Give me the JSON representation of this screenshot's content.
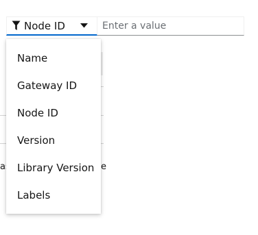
{
  "filter": {
    "selected_label": "Node ID",
    "filter_icon": "filter-icon",
    "caret_icon": "caret-down-icon"
  },
  "search": {
    "placeholder": "Enter a value",
    "value": ""
  },
  "menu": {
    "items": [
      {
        "label": "Name"
      },
      {
        "label": "Gateway ID"
      },
      {
        "label": "Node ID"
      },
      {
        "label": "Version"
      },
      {
        "label": "Library Version"
      },
      {
        "label": "Labels"
      }
    ]
  },
  "background": {
    "left_fragment": "as",
    "right_fragment": "e"
  },
  "colors": {
    "accent": "#0066cc",
    "text": "#151515",
    "placeholder": "#6a6e73",
    "border": "#8a8d90"
  }
}
